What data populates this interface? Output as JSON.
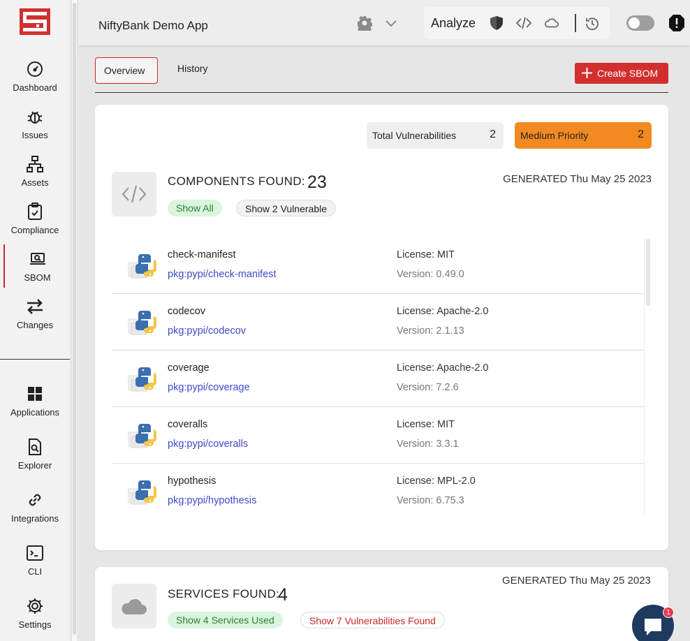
{
  "app_title": "NiftyBank Demo App",
  "sidebar": {
    "items": [
      {
        "label": "Dashboard",
        "icon": "dashboard-gauge-icon"
      },
      {
        "label": "Issues",
        "icon": "bug-icon"
      },
      {
        "label": "Assets",
        "icon": "sitemap-icon"
      },
      {
        "label": "Compliance",
        "icon": "clipboard-check-icon"
      },
      {
        "label": "SBOM",
        "icon": "laptop-search-icon",
        "active": true
      },
      {
        "label": "Changes",
        "icon": "arrows-exchange-icon"
      },
      {
        "label": "Applications",
        "icon": "grid-icon"
      },
      {
        "label": "Explorer",
        "icon": "document-search-icon"
      },
      {
        "label": "Integrations",
        "icon": "link-icon"
      },
      {
        "label": "CLI",
        "icon": "terminal-icon"
      },
      {
        "label": "Settings",
        "icon": "gear-icon"
      }
    ]
  },
  "header": {
    "analyze_label": "Analyze"
  },
  "tabs": [
    {
      "label": "Overview",
      "active": true
    },
    {
      "label": "History",
      "active": false
    }
  ],
  "create_sbom_label": "Create SBOM",
  "stats": {
    "total_label": "Total Vulnerabilities",
    "total_value": "2",
    "medium_label": "Medium Priority",
    "medium_value": "2"
  },
  "components": {
    "title": "COMPONENTS FOUND:",
    "count": "23",
    "generated": "GENERATED Thu May 25 2023",
    "show_all_label": "Show All",
    "show_vulnerable_label": "Show 2 Vulnerable",
    "rows": [
      {
        "name": "check-manifest",
        "pkg": "pkg:pypi/check-manifest",
        "license": "License: MIT",
        "version": "Version: 0.49.0"
      },
      {
        "name": "codecov",
        "pkg": "pkg:pypi/codecov",
        "license": "License: Apache-2.0",
        "version": "Version: 2.1.13"
      },
      {
        "name": "coverage",
        "pkg": "pkg:pypi/coverage",
        "license": "License: Apache-2.0",
        "version": "Version: 7.2.6"
      },
      {
        "name": "coveralls",
        "pkg": "pkg:pypi/coveralls",
        "license": "License: MIT",
        "version": "Version: 3.3.1"
      },
      {
        "name": "hypothesis",
        "pkg": "pkg:pypi/hypothesis",
        "license": "License: MPL-2.0",
        "version": "Version: 6.75.3"
      }
    ]
  },
  "services": {
    "title": "SERVICES FOUND:",
    "count": "4",
    "generated": "GENERATED Thu May 25 2023",
    "used_label": "Show 4 Services Used",
    "vulns_label": "Show 7 Vulnerabilities Found"
  },
  "chat_badge": "1",
  "colors": {
    "brand_red": "#d32f2f",
    "medium_orange": "#f28a22",
    "link_blue": "#3d49c7",
    "green_pill": "#d9f5de"
  }
}
